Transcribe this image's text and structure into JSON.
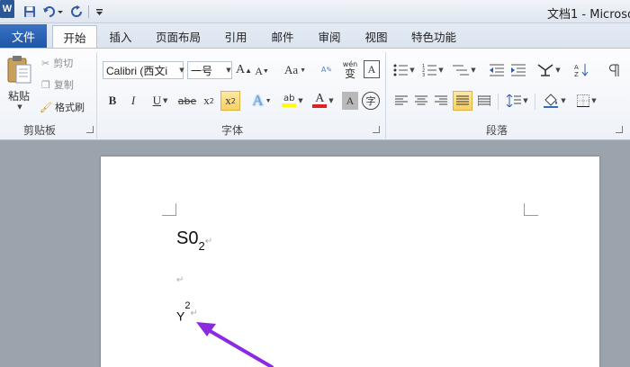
{
  "window": {
    "title": "文档1 - Microso"
  },
  "qat": {
    "app_logo": "W",
    "save_icon": "save-icon",
    "undo_icon": "undo-icon",
    "redo_icon": "redo-icon"
  },
  "tabs": [
    {
      "label": "文件"
    },
    {
      "label": "开始"
    },
    {
      "label": "插入"
    },
    {
      "label": "页面布局"
    },
    {
      "label": "引用"
    },
    {
      "label": "邮件"
    },
    {
      "label": "审阅"
    },
    {
      "label": "视图"
    },
    {
      "label": "特色功能"
    }
  ],
  "clipboard": {
    "group_label": "剪贴板",
    "paste_label": "粘贴",
    "cut_label": "剪切",
    "copy_label": "复制",
    "format_painter_label": "格式刷"
  },
  "font": {
    "group_label": "字体",
    "font_name": "Calibri (西文i",
    "font_size": "一号",
    "grow_label": "A",
    "shrink_label": "A",
    "case_label": "Aa",
    "wen_label": "wén",
    "wen_char": "变",
    "border_char_label": "A",
    "bold": "B",
    "italic": "I",
    "underline": "U",
    "strike": "abe",
    "subscript": "x",
    "subscript_mark": "2",
    "superscript": "x",
    "superscript_mark": "2",
    "effects_label": "A",
    "highlight_label": "ab",
    "color_label": "A",
    "shade_label": "A",
    "circle_char": "字"
  },
  "paragraph": {
    "group_label": "段落"
  },
  "colors": {
    "file_tab": "#2b63b6",
    "highlight": "#f9d163",
    "font_color_bar": "#e02020",
    "highlight_bar": "#ffff00",
    "arrow": "#8a2be2"
  },
  "document": {
    "line1_text": "S0",
    "line1_sub": "2",
    "line1_mark": "↵",
    "line2_mark": "↵",
    "line3_text": "Y",
    "line3_sup": "2",
    "line3_mark": "↵"
  }
}
